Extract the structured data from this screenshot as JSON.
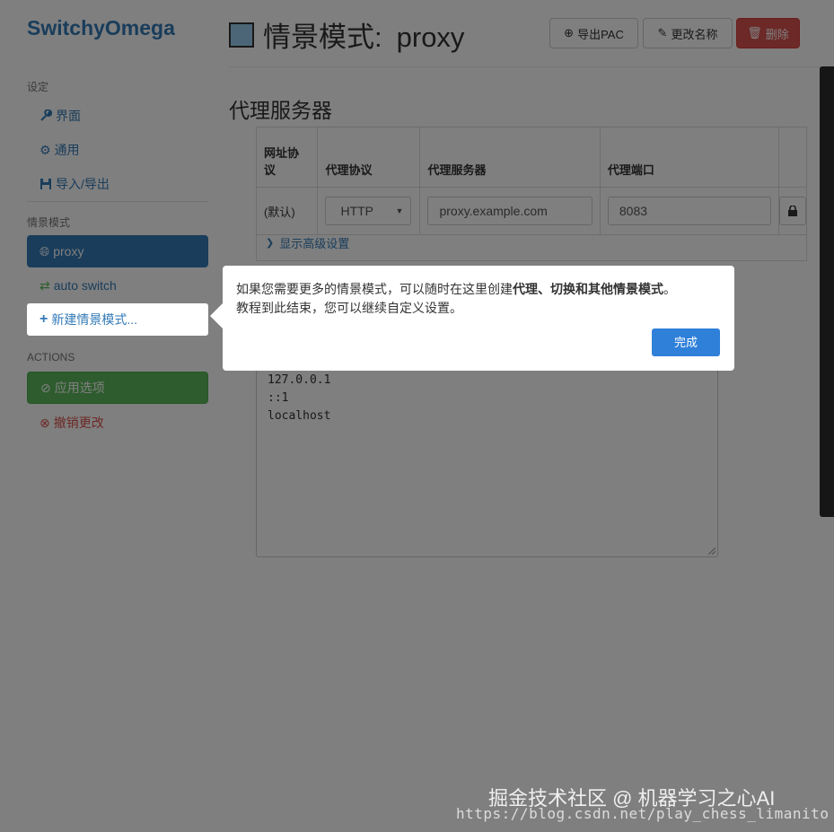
{
  "brand": "SwitchyOmega",
  "sidebar": {
    "settings_header": "设定",
    "settings_items": [
      {
        "label": "界面",
        "icon": "wrench-icon"
      },
      {
        "label": "通用",
        "icon": "gear-icon"
      },
      {
        "label": "导入/导出",
        "icon": "import-export-icon"
      }
    ],
    "profiles_header": "情景模式",
    "profiles": [
      {
        "label": "proxy",
        "icon": "globe-icon",
        "active": true
      },
      {
        "label": "auto switch",
        "icon": "switch-icon"
      }
    ],
    "new_profile_label": "新建情景模式...",
    "actions_header": "ACTIONS",
    "apply_label": "应用选项",
    "discard_label": "撤销更改"
  },
  "header": {
    "title_prefix": "情景模式:",
    "profile_name": "proxy",
    "export_pac_label": "导出PAC",
    "rename_label": "更改名称",
    "delete_label": "删除"
  },
  "section": {
    "title": "代理服务器"
  },
  "proxy_table": {
    "headers": [
      "网址协议",
      "代理协议",
      "代理服务器",
      "代理端口"
    ],
    "row": {
      "scheme": "(默认)",
      "protocol": "HTTP",
      "server": "proxy.example.com",
      "port": "8083"
    },
    "advanced_label": "显示高级设置"
  },
  "bypass_list": [
    "127.0.0.1",
    "::1",
    "localhost"
  ],
  "tutorial": {
    "text_part1": "如果您需要更多的情景模式，可以随时在这里创建",
    "text_bold": "代理、切换和其他情景模式",
    "text_part2": "。",
    "line2": "教程到此结束，您可以继续自定义设置。",
    "done_label": "完成"
  },
  "watermark": {
    "line1": "掘金技术社区 @ 机器学习之心AI",
    "line2": "https://blog.csdn.net/play_chess_limanito"
  },
  "colors": {
    "brand": "#337ab7",
    "active_profile": "#337ab7",
    "apply": "#5cb85c",
    "danger": "#d9534f",
    "done_button": "#2f80d9"
  }
}
